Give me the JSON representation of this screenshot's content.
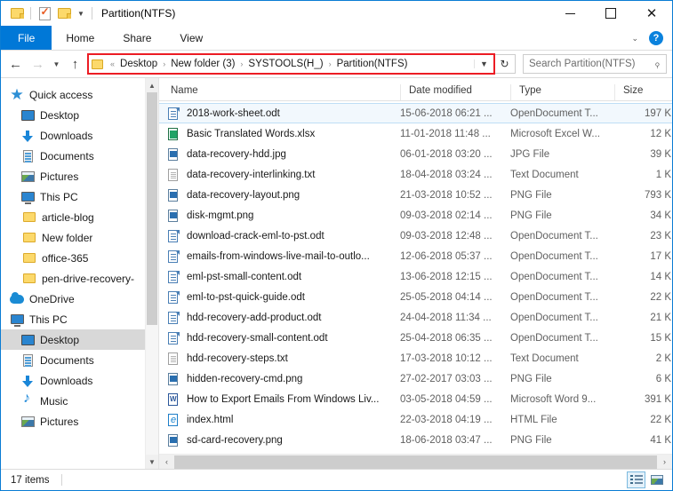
{
  "window": {
    "title": "Partition(NTFS)",
    "quick_access_toolbar": [
      {
        "name": "folder-icon",
        "label": ""
      },
      {
        "name": "properties-icon",
        "label": ""
      },
      {
        "name": "new-folder-icon",
        "label": ""
      },
      {
        "name": "customize-dropdown-icon",
        "label": "▾"
      }
    ],
    "controls": {
      "minimize": "",
      "maximize": "",
      "close": "✕"
    }
  },
  "ribbon": {
    "tabs": [
      {
        "label": "File",
        "active": true
      },
      {
        "label": "Home",
        "active": false
      },
      {
        "label": "Share",
        "active": false
      },
      {
        "label": "View",
        "active": false
      }
    ],
    "expand_label": "⌄",
    "help_label": "?"
  },
  "address": {
    "back_label": "←",
    "forward_label": "→",
    "recent_label": "⌄",
    "up_label": "↑",
    "overflow_label": "«",
    "crumbs": [
      "Desktop",
      "New folder (3)",
      "SYSTOOLS(H_)",
      "Partition(NTFS)"
    ],
    "separator": "›",
    "dropdown_label": "⌄",
    "refresh_label": "↻",
    "highlight_color": "#ec1c24"
  },
  "search": {
    "placeholder": "Search Partition(NTFS)",
    "icon_label": "⌕"
  },
  "sidebar": {
    "items": [
      {
        "label": "Quick access",
        "icon": "quick-access-star-icon",
        "indent": 10,
        "pinned": false,
        "selected": false
      },
      {
        "label": "Desktop",
        "icon": "desktop-icon",
        "indent": 22,
        "pinned": true,
        "selected": false
      },
      {
        "label": "Downloads",
        "icon": "downloads-icon",
        "indent": 22,
        "pinned": true,
        "selected": false
      },
      {
        "label": "Documents",
        "icon": "documents-icon",
        "indent": 22,
        "pinned": true,
        "selected": false
      },
      {
        "label": "Pictures",
        "icon": "pictures-icon",
        "indent": 22,
        "pinned": true,
        "selected": false
      },
      {
        "label": "This PC",
        "icon": "this-pc-icon",
        "indent": 22,
        "pinned": true,
        "selected": false
      },
      {
        "label": "article-blog",
        "icon": "folder-icon",
        "indent": 24,
        "pinned": false,
        "selected": false
      },
      {
        "label": "New folder",
        "icon": "folder-icon",
        "indent": 24,
        "pinned": false,
        "selected": false
      },
      {
        "label": "office-365",
        "icon": "folder-icon",
        "indent": 24,
        "pinned": false,
        "selected": false
      },
      {
        "label": "pen-drive-recovery-",
        "icon": "folder-icon",
        "indent": 24,
        "pinned": false,
        "selected": false
      },
      {
        "label": "OneDrive",
        "icon": "onedrive-icon",
        "indent": 10,
        "pinned": false,
        "selected": false
      },
      {
        "label": "This PC",
        "icon": "this-pc-icon",
        "indent": 10,
        "pinned": false,
        "selected": false
      },
      {
        "label": "Desktop",
        "icon": "desktop-icon",
        "indent": 22,
        "pinned": false,
        "selected": true
      },
      {
        "label": "Documents",
        "icon": "documents-icon",
        "indent": 22,
        "pinned": false,
        "selected": false
      },
      {
        "label": "Downloads",
        "icon": "downloads-icon",
        "indent": 22,
        "pinned": false,
        "selected": false
      },
      {
        "label": "Music",
        "icon": "music-icon",
        "indent": 22,
        "pinned": false,
        "selected": false
      },
      {
        "label": "Pictures",
        "icon": "pictures-icon",
        "indent": 22,
        "pinned": false,
        "selected": false
      }
    ],
    "scroll_up_label": "⌃",
    "scroll_down_label": "⌄"
  },
  "filelist": {
    "sort_indicator": "⌃",
    "columns": [
      {
        "label": "Name",
        "key": "name"
      },
      {
        "label": "Date modified",
        "key": "date"
      },
      {
        "label": "Type",
        "key": "type"
      },
      {
        "label": "Size",
        "key": "size"
      }
    ],
    "rows": [
      {
        "name": "2018-work-sheet.odt",
        "date": "15-06-2018 06:21 ...",
        "type": "OpenDocument T...",
        "size": "197 K",
        "icon": "odt",
        "selected": true
      },
      {
        "name": "Basic Translated Words.xlsx",
        "date": "11-01-2018 11:48 ...",
        "type": "Microsoft Excel W...",
        "size": "12 K",
        "icon": "xlsx",
        "selected": false
      },
      {
        "name": "data-recovery-hdd.jpg",
        "date": "06-01-2018 03:20 ...",
        "type": "JPG File",
        "size": "39 K",
        "icon": "img",
        "selected": false
      },
      {
        "name": "data-recovery-interlinking.txt",
        "date": "18-04-2018 03:24 ...",
        "type": "Text Document",
        "size": "1 K",
        "icon": "txt",
        "selected": false
      },
      {
        "name": "data-recovery-layout.png",
        "date": "21-03-2018 10:52 ...",
        "type": "PNG File",
        "size": "793 K",
        "icon": "img",
        "selected": false
      },
      {
        "name": "disk-mgmt.png",
        "date": "09-03-2018 02:14 ...",
        "type": "PNG File",
        "size": "34 K",
        "icon": "img",
        "selected": false
      },
      {
        "name": "download-crack-eml-to-pst.odt",
        "date": "09-03-2018 12:48 ...",
        "type": "OpenDocument T...",
        "size": "23 K",
        "icon": "odt",
        "selected": false
      },
      {
        "name": "emails-from-windows-live-mail-to-outlo...",
        "date": "12-06-2018 05:37 ...",
        "type": "OpenDocument T...",
        "size": "17 K",
        "icon": "odt",
        "selected": false
      },
      {
        "name": "eml-pst-small-content.odt",
        "date": "13-06-2018 12:15 ...",
        "type": "OpenDocument T...",
        "size": "14 K",
        "icon": "odt",
        "selected": false
      },
      {
        "name": "eml-to-pst-quick-guide.odt",
        "date": "25-05-2018 04:14 ...",
        "type": "OpenDocument T...",
        "size": "22 K",
        "icon": "odt",
        "selected": false
      },
      {
        "name": "hdd-recovery-add-product.odt",
        "date": "24-04-2018 11:34 ...",
        "type": "OpenDocument T...",
        "size": "21 K",
        "icon": "odt",
        "selected": false
      },
      {
        "name": "hdd-recovery-small-content.odt",
        "date": "25-04-2018 06:35 ...",
        "type": "OpenDocument T...",
        "size": "15 K",
        "icon": "odt",
        "selected": false
      },
      {
        "name": "hdd-recovery-steps.txt",
        "date": "17-03-2018 10:12 ...",
        "type": "Text Document",
        "size": "2 K",
        "icon": "txt",
        "selected": false
      },
      {
        "name": "hidden-recovery-cmd.png",
        "date": "27-02-2017 03:03 ...",
        "type": "PNG File",
        "size": "6 K",
        "icon": "img",
        "selected": false
      },
      {
        "name": "How to Export Emails From Windows Liv...",
        "date": "03-05-2018 04:59 ...",
        "type": "Microsoft Word 9...",
        "size": "391 K",
        "icon": "doc",
        "selected": false
      },
      {
        "name": "index.html",
        "date": "22-03-2018 04:19 ...",
        "type": "HTML File",
        "size": "22 K",
        "icon": "html",
        "selected": false
      },
      {
        "name": "sd-card-recovery.png",
        "date": "18-06-2018 03:47 ...",
        "type": "PNG File",
        "size": "41 K",
        "icon": "img",
        "selected": false
      }
    ],
    "hscroll_left_label": "‹",
    "hscroll_right_label": "›"
  },
  "statusbar": {
    "item_count": "17 items",
    "view_buttons": [
      {
        "name": "details-view-button",
        "active": true
      },
      {
        "name": "large-icons-view-button",
        "active": false
      }
    ]
  }
}
